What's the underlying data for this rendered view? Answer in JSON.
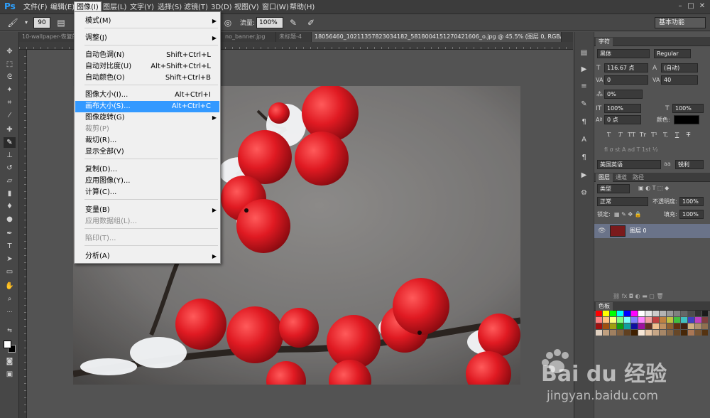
{
  "app": {
    "logo": "Ps"
  },
  "menubar": {
    "items": [
      "文件(F)",
      "编辑(E)",
      "图像(I)",
      "图层(L)",
      "文字(Y)",
      "选择(S)",
      "滤镜(T)",
      "3D(D)",
      "视图(V)",
      "窗口(W)",
      "帮助(H)"
    ],
    "window_controls": [
      "–",
      "□",
      "✕"
    ]
  },
  "options_bar": {
    "brush_size": "90",
    "flow_label": "流量:",
    "flow_value": "100%",
    "opacity_value": "100%",
    "workspace": "基本功能"
  },
  "tabs": [
    {
      "label": "10-wallpaper-恢复的",
      "active": false
    },
    {
      "label": "no_banner.jpg",
      "active": false
    },
    {
      "label": "未标题-4",
      "active": false
    },
    {
      "label": "18056460_1021135782303418​2_5818004151270421606_o.jpg @ 45.5% (图层 0, RGB/8) *",
      "active": true
    }
  ],
  "image_menu": {
    "items": [
      {
        "label": "模式(M)",
        "shortcut": "",
        "submenu": true,
        "disabled": false
      },
      {
        "label": "调整(J)",
        "shortcut": "",
        "submenu": true,
        "disabled": false
      },
      {
        "label": "自动色调(N)",
        "shortcut": "Shift+Ctrl+L",
        "submenu": false,
        "disabled": false
      },
      {
        "label": "自动对比度(U)",
        "shortcut": "Alt+Shift+Ctrl+L",
        "submenu": false,
        "disabled": false
      },
      {
        "label": "自动颜色(O)",
        "shortcut": "Shift+Ctrl+B",
        "submenu": false,
        "disabled": false
      },
      {
        "label": "图像大小(I)...",
        "shortcut": "Alt+Ctrl+I",
        "submenu": false,
        "disabled": false
      },
      {
        "label": "画布大小(S)...",
        "shortcut": "Alt+Ctrl+C",
        "submenu": false,
        "disabled": false,
        "highlighted": true
      },
      {
        "label": "图像旋转(G)",
        "shortcut": "",
        "submenu": true,
        "disabled": false
      },
      {
        "label": "裁剪(P)",
        "shortcut": "",
        "submenu": false,
        "disabled": true
      },
      {
        "label": "裁切(R)...",
        "shortcut": "",
        "submenu": false,
        "disabled": false
      },
      {
        "label": "显示全部(V)",
        "shortcut": "",
        "submenu": false,
        "disabled": false
      },
      {
        "label": "复制(D)...",
        "shortcut": "",
        "submenu": false,
        "disabled": false
      },
      {
        "label": "应用图像(Y)...",
        "shortcut": "",
        "submenu": false,
        "disabled": false
      },
      {
        "label": "计算(C)...",
        "shortcut": "",
        "submenu": false,
        "disabled": false
      },
      {
        "label": "变量(B)",
        "shortcut": "",
        "submenu": true,
        "disabled": false
      },
      {
        "label": "应用数据组(L)...",
        "shortcut": "",
        "submenu": false,
        "disabled": true
      },
      {
        "label": "陷印(T)...",
        "shortcut": "",
        "submenu": false,
        "disabled": true
      },
      {
        "label": "分析(A)",
        "shortcut": "",
        "submenu": true,
        "disabled": false
      }
    ]
  },
  "character_panel": {
    "tab": "字符",
    "font_family": "黑体",
    "font_style": "Regular",
    "font_size": "116.67 点",
    "leading": "(自动)",
    "kerning": "0",
    "tracking": "40",
    "vertical_scale_shift": "0%",
    "vertical_scale": "100%",
    "horizontal_scale": "100%",
    "baseline": "0 点",
    "color_label": "颜色:",
    "style_buttons": [
      "T",
      "T",
      "TT",
      "Tr",
      "T¹",
      "T,",
      "T",
      "T"
    ],
    "language": "美国英语",
    "antialias": "锐利",
    "antialias_icon": "aa"
  },
  "layers_panel": {
    "tabs": [
      "图层",
      "通道",
      "路径"
    ],
    "filter": "类型",
    "blend_mode": "正常",
    "opacity_label": "不透明度:",
    "opacity": "100%",
    "lock_label": "锁定:",
    "fill_label": "填充:",
    "fill": "100%",
    "layers": [
      {
        "name": "图层 0",
        "visible": true
      }
    ]
  },
  "swatches_panel": {
    "tab": "色板"
  },
  "watermark": {
    "brand": "Bai du 经验",
    "url": "jingyan.baidu.com"
  },
  "colors": {
    "accent": "#3399ff",
    "layer_selected": "#6a7389",
    "berry": "#d4151f"
  }
}
